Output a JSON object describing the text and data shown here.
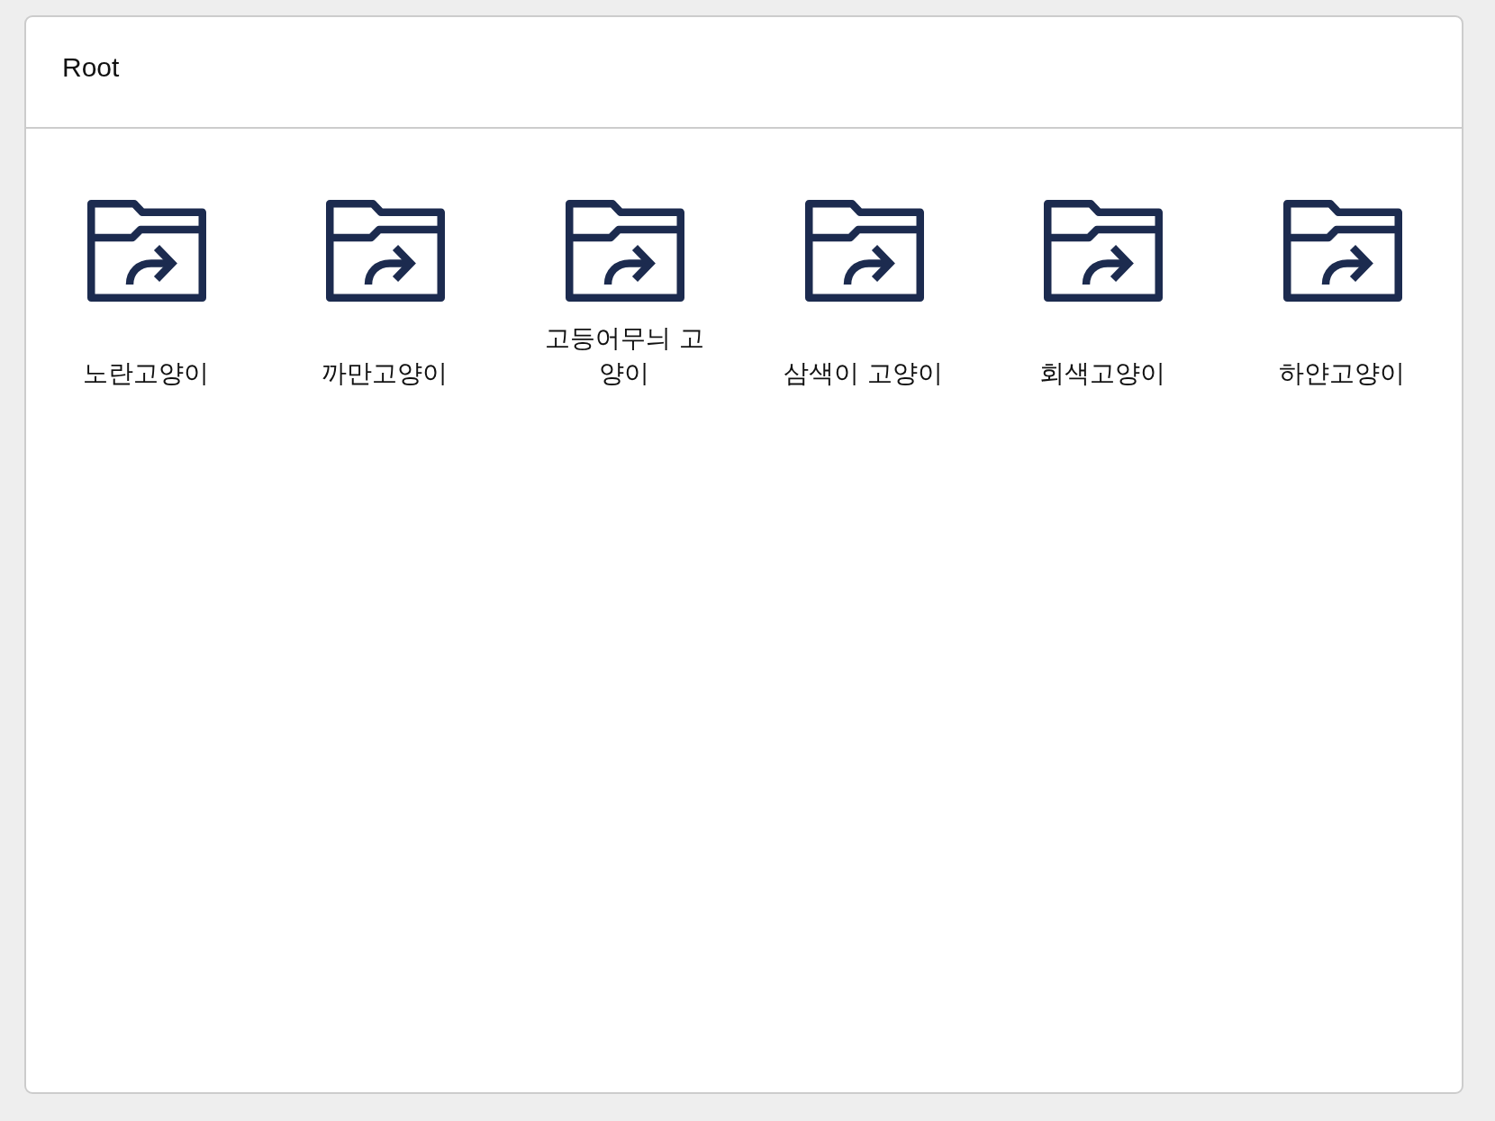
{
  "header": {
    "title": "Root"
  },
  "folders": [
    {
      "name": "노란고양이"
    },
    {
      "name": "까만고양이"
    },
    {
      "name": "고등어무늬 고양이"
    },
    {
      "name": "삼색이 고양이"
    },
    {
      "name": "회색고양이"
    },
    {
      "name": "하얀고양이"
    }
  ]
}
